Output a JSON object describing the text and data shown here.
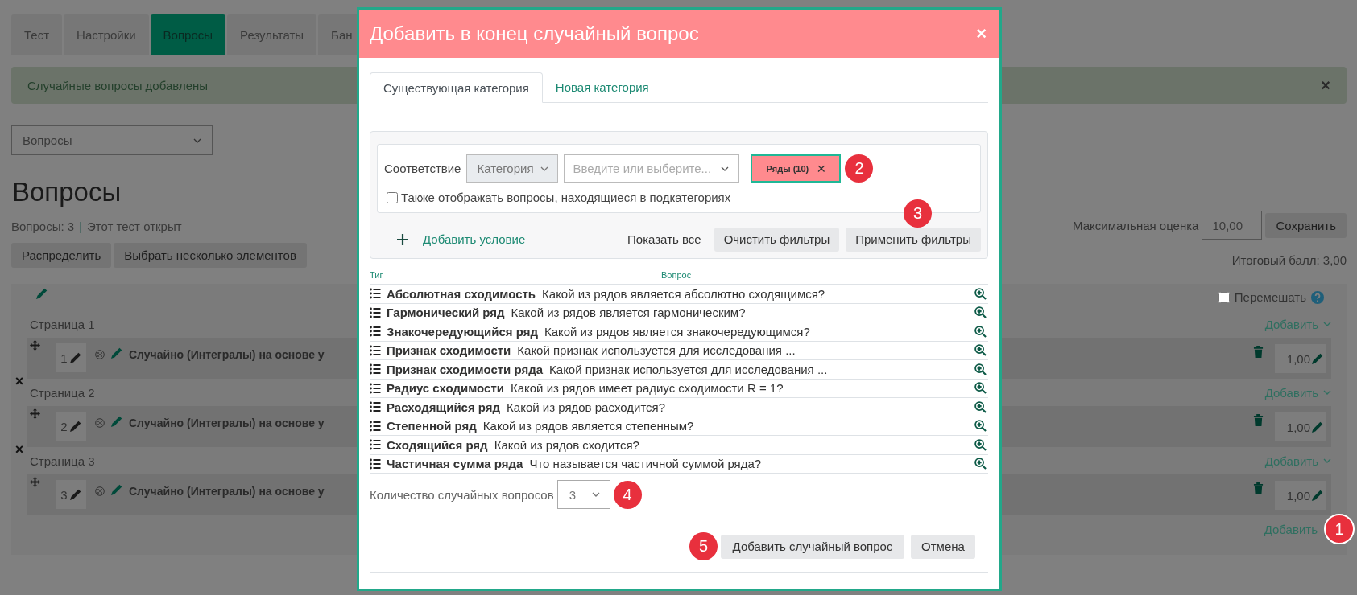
{
  "tabs": [
    {
      "label": "Тест",
      "selected": false
    },
    {
      "label": "Настройки",
      "selected": false
    },
    {
      "label": "Вопросы",
      "selected": true
    },
    {
      "label": "Результаты",
      "selected": false
    },
    {
      "label": "Бан",
      "selected": false
    }
  ],
  "alert": {
    "message": "Случайные вопросы добавлены",
    "close": "×"
  },
  "view_select": {
    "value": "Вопросы"
  },
  "heading": "Вопросы",
  "summary": {
    "count": "Вопросы: 3",
    "separator": "|",
    "status": "Этот тест открыт"
  },
  "actions": [
    "Распределить",
    "Выбрать несколько элементов"
  ],
  "max_grade": {
    "label": "Максимальная оценка",
    "value": "10,00",
    "button": "Сохранить"
  },
  "total": "Итоговый балл: 3,00",
  "shuffle": {
    "label": "Перемешать",
    "checked": false
  },
  "pages": [
    {
      "title": "Страница 1",
      "add": "Добавить",
      "question": {
        "number": "1",
        "title": "Случайно (Интегралы) на основе у",
        "mark": "1,00"
      }
    },
    {
      "remove": "×",
      "title": "Страница 2",
      "add": "Добавить",
      "question": {
        "number": "2",
        "title": "Случайно (Интегралы) на основе у",
        "mark": "1,00"
      }
    },
    {
      "remove": "×",
      "title": "Страница 3",
      "add": "Добавить",
      "question": {
        "number": "3",
        "title": "Случайно (Интегралы) на основе у",
        "mark": "1,00"
      }
    }
  ],
  "add_last": {
    "label": "Добавить",
    "callout": "1"
  },
  "dialog": {
    "title": "Добавить в конец случайный вопрос",
    "close": "×",
    "tabs": [
      {
        "label": "Существующая категория",
        "selected": true
      },
      {
        "label": "Новая категория",
        "selected": false
      }
    ],
    "filter": {
      "match_label": "Соответствие",
      "type_select": "Категория",
      "value_placeholder": "Введите или выберите...",
      "chips": [
        {
          "label": "Ряды (10)",
          "remove": "×"
        }
      ],
      "callout": "2",
      "subcategories": {
        "label": "Также отображать вопросы, находящиеся в подкатегориях",
        "checked": false
      },
      "add_condition": "Добавить условие",
      "show_all": "Показать все",
      "clear": "Очистить фильтры",
      "apply": {
        "label": "Применить фильтры",
        "callout": "3"
      }
    },
    "columns": [
      "Тиг",
      "Вопрос"
    ],
    "questions": [
      {
        "name": "Абсолютная сходимость",
        "text": "Какой из рядов является абсолютно сходящимся?"
      },
      {
        "name": "Гармонический ряд",
        "text": "Какой из рядов является гармоническим?"
      },
      {
        "name": "Знакочередующийся ряд",
        "text": "Какой из рядов является знакочередующимся?"
      },
      {
        "name": "Признак сходимости",
        "text": "Какой признак используется для исследования ..."
      },
      {
        "name": "Признак сходимости ряда",
        "text": "Какой признак используется для исследования ..."
      },
      {
        "name": "Радиус сходимости",
        "text": "Какой из рядов имеет радиус сходимости R = 1?"
      },
      {
        "name": "Расходящийся ряд",
        "text": "Какой из рядов расходится?"
      },
      {
        "name": "Степенной ряд",
        "text": "Какой из рядов является степенным?"
      },
      {
        "name": "Сходящийся ряд",
        "text": "Какой из рядов сходится?"
      },
      {
        "name": "Частичная сумма ряда",
        "text": "Что называется частичной суммой ряда?"
      }
    ],
    "count": {
      "label": "Количество случайных вопросов",
      "value": "3",
      "callout": "4"
    },
    "buttons": {
      "callout": "5",
      "add": "Добавить случайный вопрос",
      "cancel": "Отмена"
    }
  }
}
